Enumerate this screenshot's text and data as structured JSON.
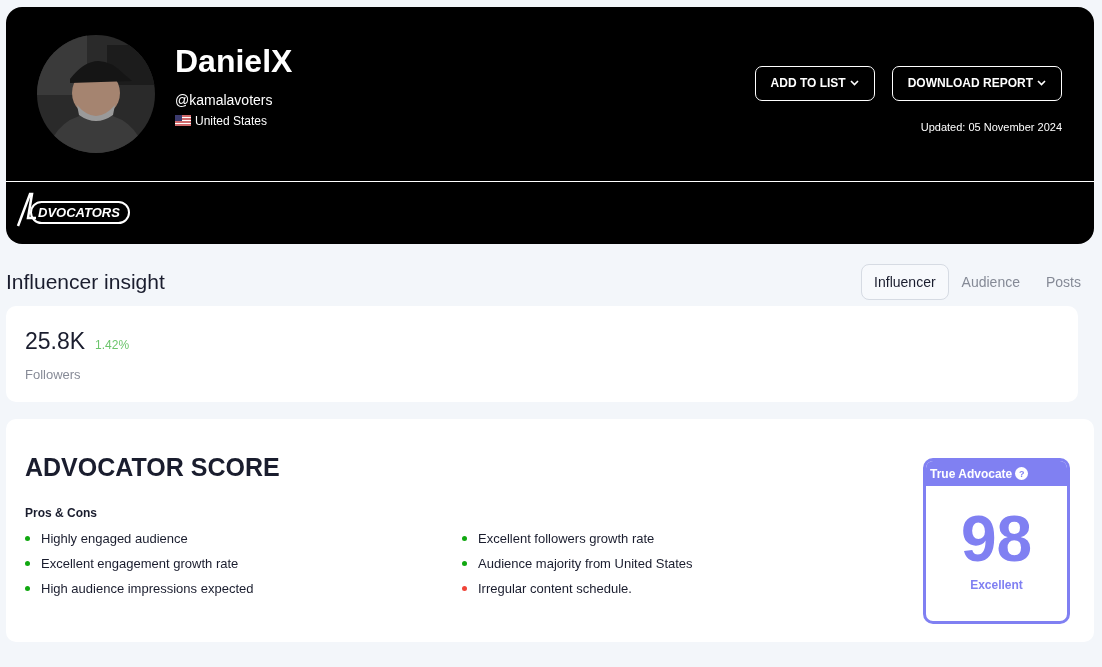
{
  "profile": {
    "name": "DanielX",
    "handle": "@kamalavoters",
    "country": "United States",
    "buttons": [
      {
        "label": "ADD TO LIST"
      },
      {
        "label": "DOWNLOAD REPORT"
      }
    ],
    "updated": "Updated: 05 November 2024",
    "logo_text": "DVOCATORS"
  },
  "section_title": "Influencer insight",
  "tabs": [
    {
      "label": "Influencer",
      "selected": true
    },
    {
      "label": "Audience",
      "selected": false
    },
    {
      "label": "Posts",
      "selected": false
    }
  ],
  "followers": {
    "value": "25.8K",
    "change": "1.42%",
    "label": "Followers"
  },
  "score": {
    "title": "ADVOCATOR SCORE",
    "subtitle": "Pros & Cons",
    "items": [
      {
        "text": "Highly engaged audience",
        "color": "#10a810"
      },
      {
        "text": "Excellent engagement growth rate",
        "color": "#10a810"
      },
      {
        "text": "High audience impressions expected",
        "color": "#10a810"
      },
      {
        "text": "Excellent followers growth rate",
        "color": "#10a810"
      },
      {
        "text": "Audience majority from United States",
        "color": "#10a810"
      },
      {
        "text": "Irregular content schedule.",
        "color": "#f04438"
      }
    ],
    "badge": {
      "title": "True Advocate",
      "help": "?",
      "value": "98",
      "rating": "Excellent"
    }
  }
}
